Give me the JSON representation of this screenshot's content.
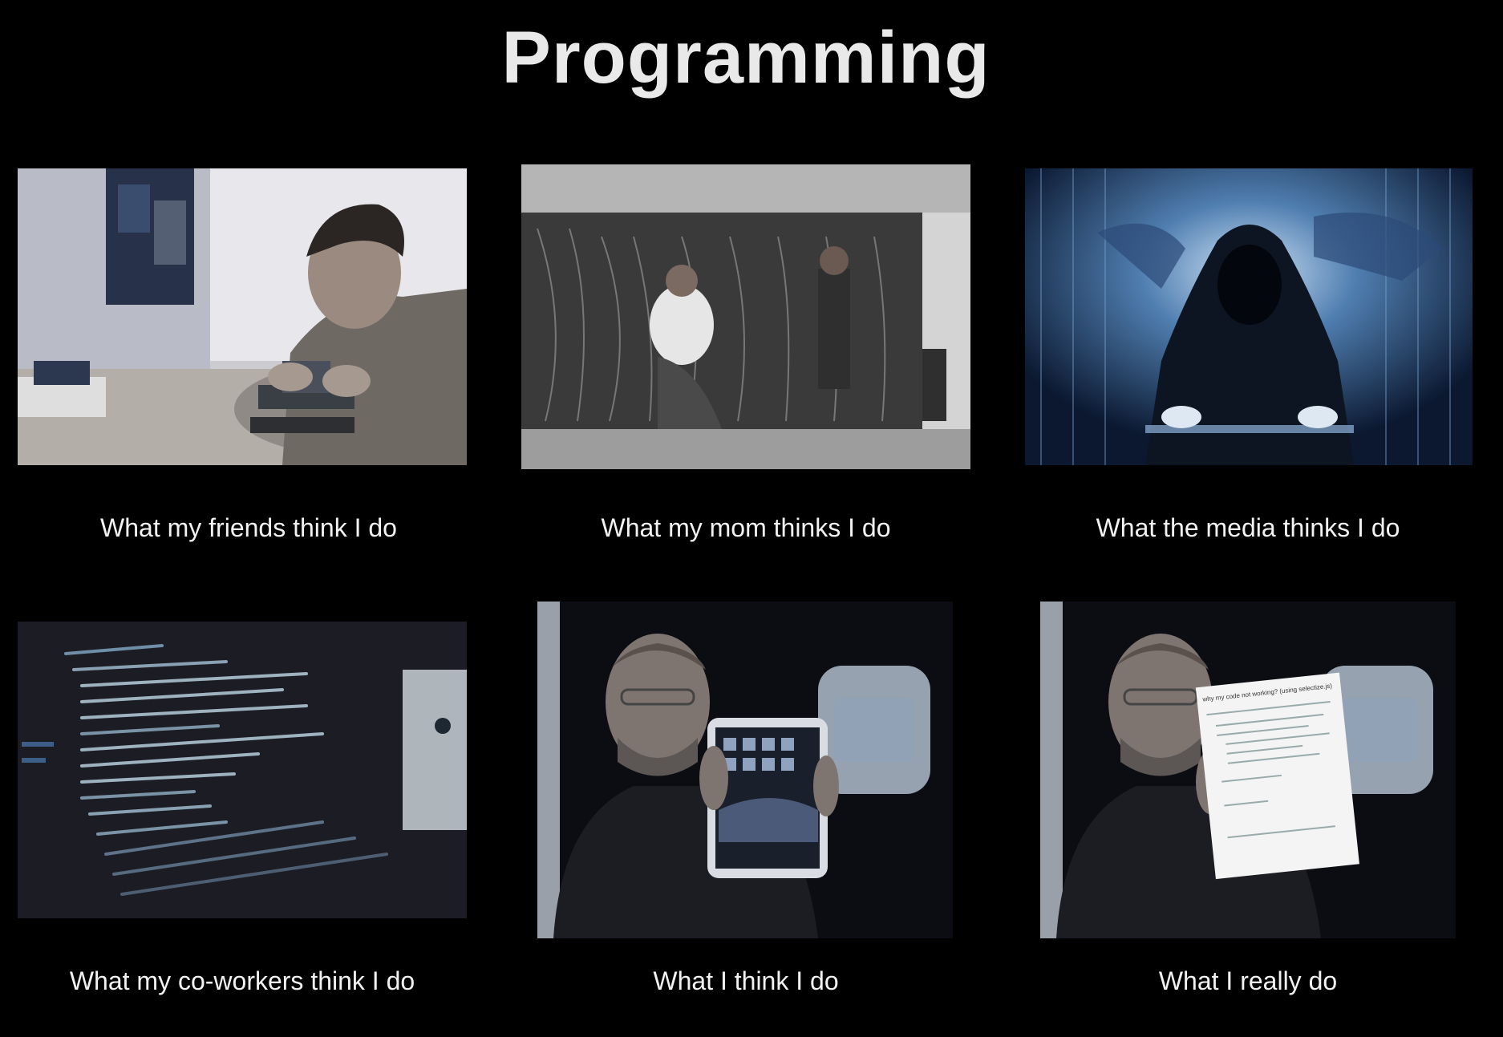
{
  "title": "Programming",
  "panels": [
    {
      "caption": "What my friends think I do",
      "image": "man-assembling-circuit-board"
    },
    {
      "caption": "What my mom thinks I do",
      "image": "women-operating-eniac-computer"
    },
    {
      "caption": "What the media thinks I do",
      "image": "hooded-hacker-with-binary-code"
    },
    {
      "caption": "What my co-workers think I do",
      "image": "html-source-code-on-screen"
    },
    {
      "caption": "What I think I do",
      "image": "presenter-holding-tablet"
    },
    {
      "caption": "What I really do",
      "image": "presenter-holding-printed-stackoverflow-page"
    }
  ],
  "paper": {
    "heading": "why my code not working? (using selectize.js)"
  },
  "colors": {
    "background": "#000000",
    "text": "#f2f2f2"
  }
}
